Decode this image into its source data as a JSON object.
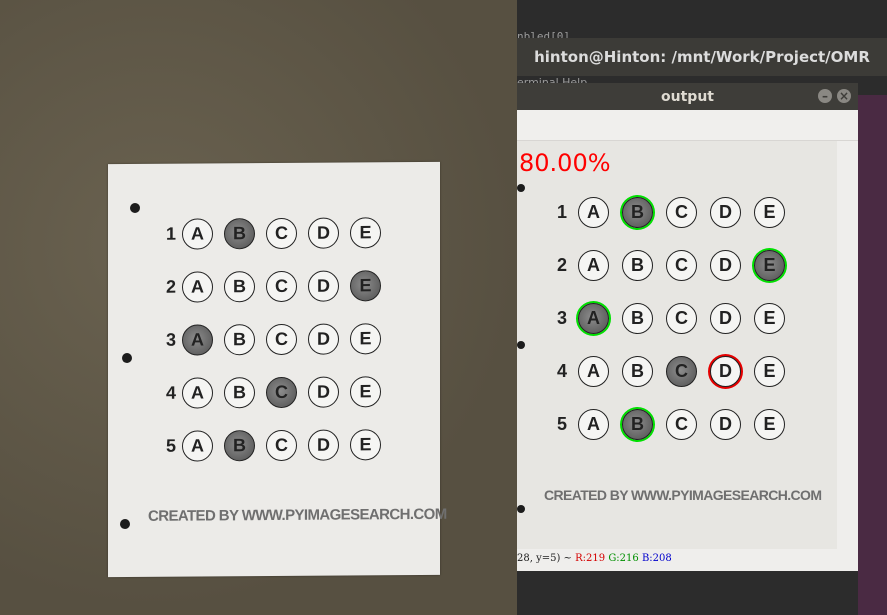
{
  "terminal": {
    "title": "hinton@Hinton: /mnt/Work/Project/OMR",
    "partial_line_1": "nbled[0]",
    "partial_line_2": "erminal  Help"
  },
  "output_window": {
    "title": "output",
    "score": "80.00%",
    "status": {
      "coords_prefix": "28, y=5) ~ ",
      "r": "R:219",
      "g": "G:216",
      "b": "B:208"
    },
    "colors": {
      "score": "#ff0000",
      "correct_ring": "#00e000",
      "wrong_ring": "#e60000"
    }
  },
  "sheet": {
    "options": [
      "A",
      "B",
      "C",
      "D",
      "E"
    ],
    "questions": [
      {
        "number": "1",
        "filled": "B",
        "result": "correct",
        "key": "B"
      },
      {
        "number": "2",
        "filled": "E",
        "result": "correct",
        "key": "E"
      },
      {
        "number": "3",
        "filled": "A",
        "result": "correct",
        "key": "A"
      },
      {
        "number": "4",
        "filled": "C",
        "result": "wrong",
        "key": "D"
      },
      {
        "number": "5",
        "filled": "B",
        "result": "correct",
        "key": "B"
      }
    ],
    "credit": "CREATED BY WWW.PYIMAGESEARCH.COM"
  }
}
